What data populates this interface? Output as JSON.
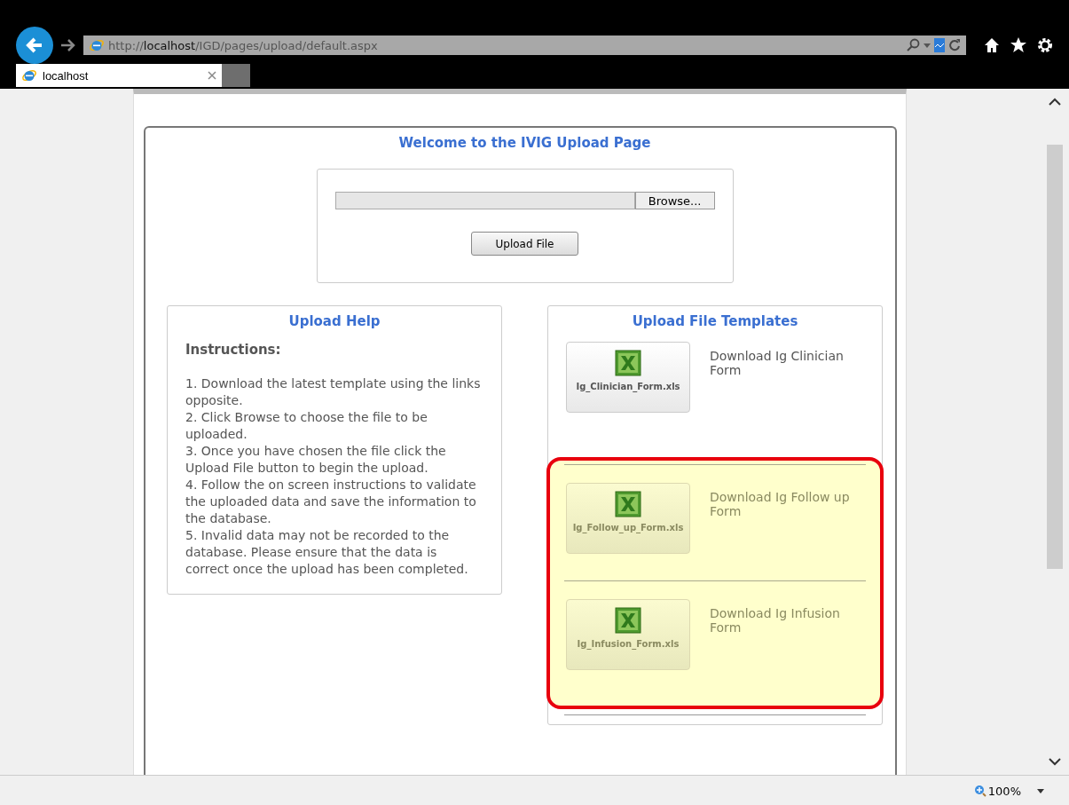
{
  "browser": {
    "address": {
      "prefix": "http://",
      "host": "localhost",
      "path": "/IGD/pages/upload/default.aspx"
    },
    "tabs": [
      {
        "label": "localhost",
        "selected": true
      }
    ],
    "zoom": "100%"
  },
  "page": {
    "title": "Welcome to the IVIG Upload Page",
    "upload": {
      "browse_button": "Browse...",
      "upload_button": "Upload File"
    },
    "help": {
      "title": "Upload Help",
      "heading": "Instructions:",
      "steps": [
        "1. Download the latest template using the links opposite.",
        "2. Click Browse to choose the file to be uploaded.",
        "3. Once you have chosen the file click the Upload File button to begin the upload.",
        "4. Follow the on screen instructions to validate the uploaded data and save the information to the database.",
        "5. Invalid data may not be recorded to the database. Please ensure that the data is correct once the upload has been completed."
      ]
    },
    "templates": {
      "title": "Upload File Templates",
      "items": [
        {
          "file": "Ig_Clinician_Form.xls",
          "label": "Download Ig Clinician Form",
          "highlighted": false
        },
        {
          "file": "Ig_Follow_up_Form.xls",
          "label": "Download Ig Follow up Form",
          "highlighted": true
        },
        {
          "file": "Ig_Infusion_Form.xls",
          "label": "Download Ig Infusion Form",
          "highlighted": true
        }
      ]
    }
  }
}
